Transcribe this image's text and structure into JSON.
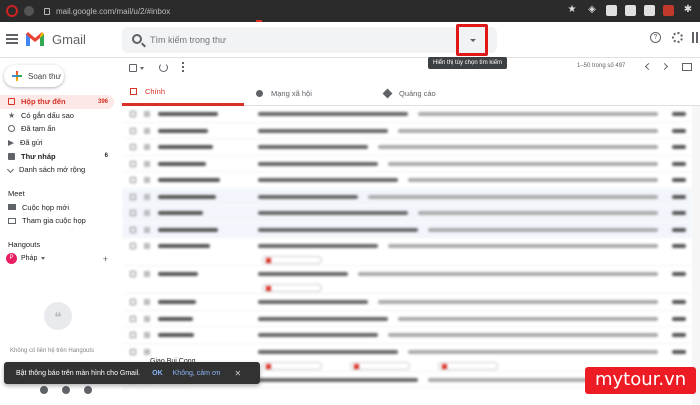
{
  "browser": {
    "url": "mail.google.com/mail/u/2/#inbox"
  },
  "app": {
    "name": "Gmail"
  },
  "search": {
    "placeholder": "Tìm kiếm trong thư",
    "options_tooltip": "Hiển thị tùy chọn tìm kiếm"
  },
  "compose": {
    "label": "Soạn thư"
  },
  "sidebar": {
    "items": [
      {
        "label": "Hộp thư đến",
        "count": "396",
        "icon": "inbox-icon"
      },
      {
        "label": "Có gắn dấu sao",
        "count": "",
        "icon": "star-icon"
      },
      {
        "label": "Đã tạm ẩn",
        "count": "",
        "icon": "clock-icon"
      },
      {
        "label": "Đã gửi",
        "count": "",
        "icon": "send-icon"
      },
      {
        "label": "Thư nháp",
        "count": "6",
        "icon": "draft-icon"
      },
      {
        "label": "Danh sách mở rộng",
        "count": "",
        "icon": "chevron-down-icon"
      }
    ],
    "meet": {
      "title": "Meet",
      "items": [
        {
          "label": "Cuộc họp mới",
          "icon": "video-icon"
        },
        {
          "label": "Tham gia cuộc họp",
          "icon": "keyboard-icon"
        }
      ]
    },
    "hangouts": {
      "title": "Hangouts",
      "user": "Pháp",
      "avatar_letter": "P",
      "empty_text": "Không có liên hệ trên Hangouts"
    }
  },
  "toolbar": {
    "pager": "1–50 trong số 497"
  },
  "tabs": [
    {
      "label": "Chính",
      "icon": "inbox-icon"
    },
    {
      "label": "Mạng xã hội",
      "icon": "people-icon"
    },
    {
      "label": "Quảng cáo",
      "icon": "tag-icon"
    }
  ],
  "emails": {
    "visible_sender": "Giao Bui Cong"
  },
  "notification": {
    "text": "Bật thông báo trên màn hình cho Gmail.",
    "ok": "OK",
    "no": "Không, cảm ơn"
  },
  "watermark": {
    "text": "mytour.vn"
  },
  "colors": {
    "accent": "#d93025",
    "highlight_box": "#e01818",
    "watermark_bg": "#ed1c24"
  }
}
